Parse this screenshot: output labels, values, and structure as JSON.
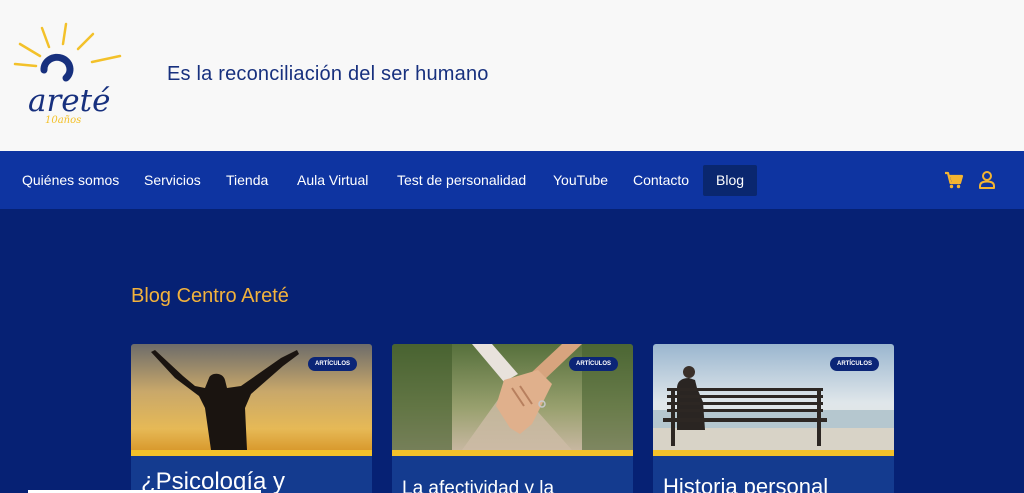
{
  "header": {
    "logo_text": "areté",
    "logo_subtext": "10años",
    "tagline": "Es la reconciliación del ser humano"
  },
  "nav": {
    "items": [
      {
        "label": "Quiénes somos"
      },
      {
        "label": "Servicios"
      },
      {
        "label": "Tienda"
      },
      {
        "label": "Aula Virtual"
      },
      {
        "label": "Test de personalidad"
      },
      {
        "label": "YouTube"
      },
      {
        "label": "Contacto"
      },
      {
        "label": "Blog",
        "active": true
      }
    ],
    "icons": [
      "cart-icon",
      "user-icon"
    ]
  },
  "main": {
    "section_title": "Blog Centro Areté",
    "cards": [
      {
        "badge": "ARTÍCULOS",
        "title": "¿Psicología y"
      },
      {
        "badge": "ARTÍCULOS",
        "title": "La afectividad y la"
      },
      {
        "badge": "ARTÍCULOS",
        "title": "Historia personal"
      }
    ]
  },
  "colors": {
    "header_bg": "#f8f8f8",
    "nav_bg": "#0e34a1",
    "nav_active_bg": "#0a276f",
    "page_bg": "#062174",
    "accent": "#f3c12a",
    "title_orange": "#f2b23c",
    "tagline_blue": "#17307e"
  }
}
